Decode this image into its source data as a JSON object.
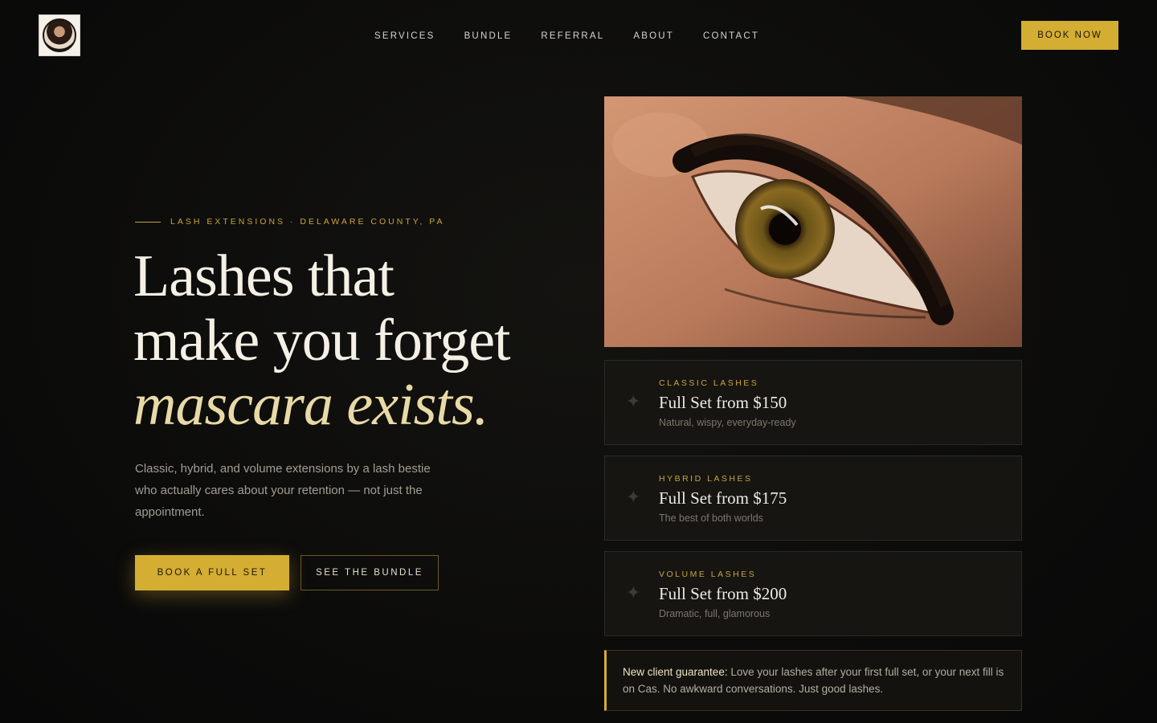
{
  "nav": {
    "logo_alt": "logo",
    "links": [
      "SERVICES",
      "BUNDLE",
      "REFERRAL",
      "ABOUT",
      "CONTACT"
    ],
    "cta": "BOOK NOW"
  },
  "hero": {
    "eyebrow": "LASH EXTENSIONS · DELAWARE COUNTY, PA",
    "headline_line1": "Lashes that",
    "headline_line2": "make you forget",
    "headline_accent": "mascara exists.",
    "lede": "Classic, hybrid, and volume extensions by a lash bestie who actually cares about your retention — not just the appointment.",
    "primary_cta": "BOOK A FULL SET",
    "secondary_cta": "SEE THE BUNDLE"
  },
  "services": [
    {
      "category": "CLASSIC LASHES",
      "price": "Full Set from $150",
      "desc": "Natural, wispy, everyday-ready"
    },
    {
      "category": "HYBRID LASHES",
      "price": "Full Set from $175",
      "desc": "The best of both worlds"
    },
    {
      "category": "VOLUME LASHES",
      "price": "Full Set from $200",
      "desc": "Dramatic, full, glamorous"
    }
  ],
  "guarantee": {
    "lead": "New client guarantee:",
    "text": " Love your lashes after your first full set, or your next fill is on Cas. No awkward conversations. Just good lashes."
  },
  "colors": {
    "accent_gold": "#d4ad33",
    "background": "#0b0b0a",
    "headline_accent": "#e9d9a6"
  }
}
